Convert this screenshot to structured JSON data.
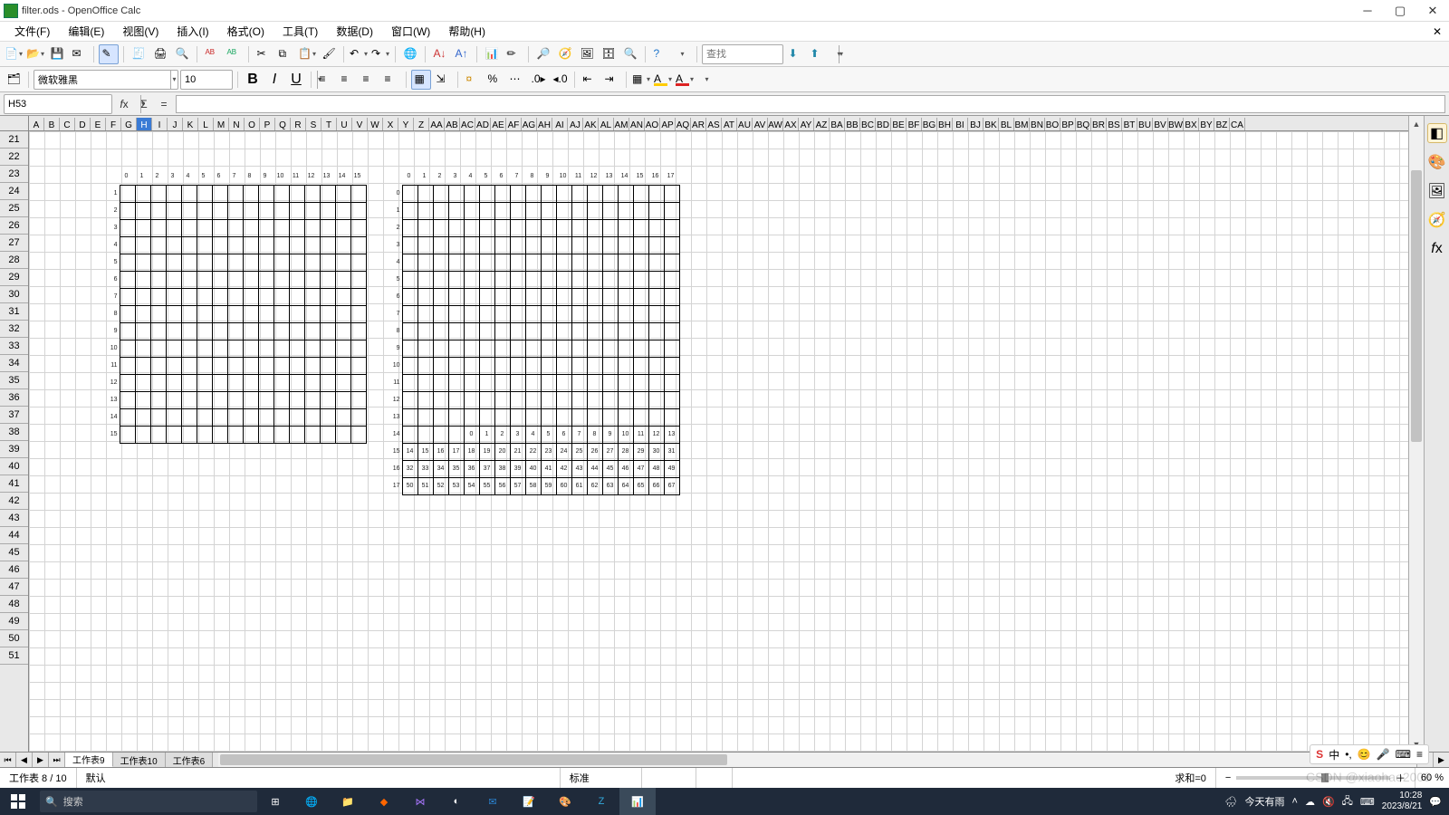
{
  "window": {
    "title": "filter.ods - OpenOffice Calc"
  },
  "menu": {
    "file": "文件(F)",
    "edit": "编辑(E)",
    "view": "视图(V)",
    "insert": "插入(I)",
    "format": "格式(O)",
    "tools": "工具(T)",
    "data": "数据(D)",
    "window": "窗口(W)",
    "help": "帮助(H)"
  },
  "toolbar2_find_placeholder": "查找",
  "font_name": "微软雅黑",
  "font_size": "10",
  "cell_ref": "H53",
  "active_col": "H",
  "columns": [
    "A",
    "B",
    "C",
    "D",
    "E",
    "F",
    "G",
    "H",
    "I",
    "J",
    "K",
    "L",
    "M",
    "N",
    "O",
    "P",
    "Q",
    "R",
    "S",
    "T",
    "U",
    "V",
    "W",
    "X",
    "Y",
    "Z",
    "AA",
    "AB",
    "AC",
    "AD",
    "AE",
    "AF",
    "AG",
    "AH",
    "AI",
    "AJ",
    "AK",
    "AL",
    "AM",
    "AN",
    "AO",
    "AP",
    "AQ",
    "AR",
    "AS",
    "AT",
    "AU",
    "AV",
    "AW",
    "AX",
    "AY",
    "AZ",
    "BA",
    "BB",
    "BC",
    "BD",
    "BE",
    "BF",
    "BG",
    "BH",
    "BI",
    "BJ",
    "BK",
    "BL",
    "BM",
    "BN",
    "BO",
    "BP",
    "BQ",
    "BR",
    "BS",
    "BT",
    "BU",
    "BV",
    "BW",
    "BX",
    "BY",
    "BZ",
    "CA"
  ],
  "row_start": 21,
  "row_end": 51,
  "grid1": {
    "x_labels": [
      "0",
      "1",
      "2",
      "3",
      "4",
      "5",
      "6",
      "7",
      "8",
      "9",
      "10",
      "11",
      "12",
      "13",
      "14",
      "15"
    ],
    "y_labels": [
      "1",
      "2",
      "3",
      "4",
      "5",
      "6",
      "7",
      "8",
      "9",
      "10",
      "11",
      "12",
      "13",
      "14",
      "15"
    ]
  },
  "grid2": {
    "x_labels": [
      "0",
      "1",
      "2",
      "3",
      "4",
      "5",
      "6",
      "7",
      "8",
      "9",
      "10",
      "11",
      "12",
      "13",
      "14",
      "15",
      "16",
      "17"
    ],
    "y_labels": [
      "0",
      "1",
      "2",
      "3",
      "4",
      "5",
      "6",
      "7",
      "8",
      "9",
      "10",
      "11",
      "12",
      "13",
      "14",
      "15",
      "16",
      "17"
    ],
    "fill_rows": [
      [
        "0",
        "1",
        "2",
        "3",
        "4",
        "5",
        "6",
        "7",
        "8",
        "9",
        "10",
        "11",
        "12",
        "13"
      ],
      [
        "14",
        "15",
        "16",
        "17",
        "18",
        "19",
        "20",
        "21",
        "22",
        "23",
        "24",
        "25",
        "26",
        "27",
        "28",
        "29",
        "30",
        "31"
      ],
      [
        "32",
        "33",
        "34",
        "35",
        "36",
        "37",
        "38",
        "39",
        "40",
        "41",
        "42",
        "43",
        "44",
        "45",
        "46",
        "47",
        "48",
        "49"
      ],
      [
        "50",
        "51",
        "52",
        "53",
        "54",
        "55",
        "56",
        "57",
        "58",
        "59",
        "60",
        "61",
        "62",
        "63",
        "64",
        "65",
        "66",
        "67"
      ]
    ],
    "fill_row_y": [
      "14",
      "15",
      "16",
      "17"
    ]
  },
  "sheet_tabs": {
    "items": [
      "工作表9",
      "工作表10",
      "工作表6"
    ],
    "active": 0
  },
  "status": {
    "sheet_pos": "工作表 8 / 10",
    "style": "默认",
    "mode": "标准",
    "sum": "求和=0",
    "zoom": "60 %"
  },
  "taskbar": {
    "search_placeholder": "搜索",
    "weather": "今天有雨",
    "time": "10:28",
    "date": "2023/8/21"
  },
  "watermark": "CSDN @xiaohao2008",
  "ime": {
    "brand_char": "S",
    "lang": "中",
    "punct": "•,",
    "emoji": "😊",
    "mic": "🎤",
    "kb": "⌨",
    "more": "≡"
  }
}
